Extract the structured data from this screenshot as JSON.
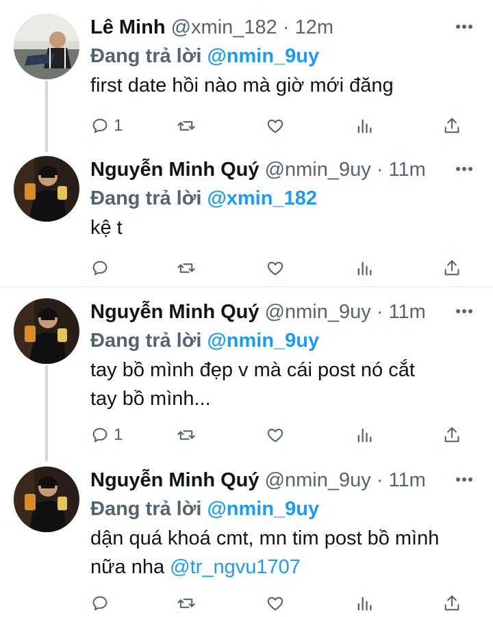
{
  "tweets": [
    {
      "name": "Lê Minh",
      "handle": "@xmin_182",
      "sep": "·",
      "time": "12m",
      "replying_prefix": "Đang trả lời",
      "replying_to": "@nmin_9uy",
      "text_lines": [
        "first date hồi nào mà giờ mới đăng"
      ],
      "reply_count": "1"
    },
    {
      "name": "Nguyễn Minh Quý",
      "handle": "@nmin_9uy",
      "sep": "·",
      "time": "11m",
      "replying_prefix": "Đang trả lời",
      "replying_to": "@xmin_182",
      "text_lines": [
        "kệ t"
      ],
      "reply_count": ""
    },
    {
      "name": "Nguyễn Minh Quý",
      "handle": "@nmin_9uy",
      "sep": "·",
      "time": "11m",
      "replying_prefix": "Đang trả lời",
      "replying_to": "@nmin_9uy",
      "text_lines": [
        "tay bồ mình đẹp v mà cái post nó cắt",
        "tay bồ mình..."
      ],
      "reply_count": "1"
    },
    {
      "name": "Nguyễn Minh Quý",
      "handle": "@nmin_9uy",
      "sep": "·",
      "time": "11m",
      "replying_prefix": "Đang trả lời",
      "replying_to": "@nmin_9uy",
      "text_lines": [
        "dận quá khoá cmt, mn tim post bồ mình",
        "nữa nha "
      ],
      "mention": "@tr_ngvu1707",
      "reply_count": ""
    }
  ],
  "icons": {
    "reply": "reply-icon",
    "retweet": "retweet-icon",
    "like": "like-icon",
    "analytics": "analytics-icon",
    "share": "share-icon",
    "more": "more-icon"
  },
  "colors": {
    "accent": "#1d9bf0",
    "secondary_text": "#536471",
    "thread_line": "#cfd9de"
  }
}
